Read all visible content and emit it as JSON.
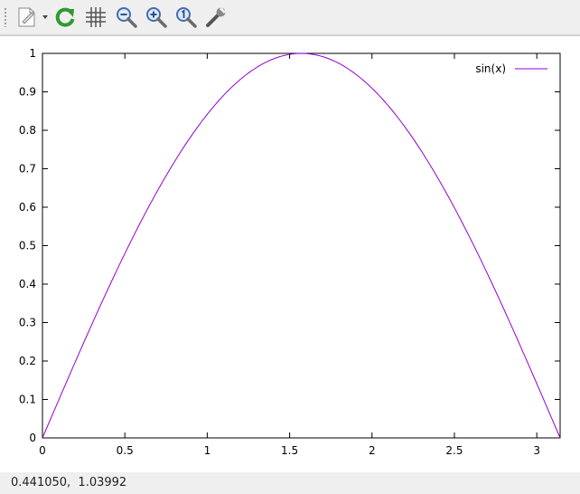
{
  "toolbar": {
    "buttons": [
      {
        "name": "export-icon",
        "has_dropdown": true
      },
      {
        "name": "replot-icon"
      },
      {
        "name": "grid-icon"
      },
      {
        "name": "zoom-out-icon"
      },
      {
        "name": "zoom-in-icon"
      },
      {
        "name": "zoom-reset-icon"
      },
      {
        "name": "settings-wrench-icon"
      }
    ]
  },
  "status": {
    "coordinates": "0.441050,  1.03992"
  },
  "colors": {
    "series": "#9400d3",
    "replot": "#2e9a2e",
    "zoom": "#3c6fb4"
  },
  "chart_data": {
    "type": "line",
    "function": "sin(x)",
    "x_range": [
      0,
      3.14159
    ],
    "ylim": [
      0,
      1
    ],
    "x_ticks": [
      "0",
      "0.5",
      "1",
      "1.5",
      "2",
      "2.5",
      "3"
    ],
    "x_tick_values": [
      0,
      0.5,
      1,
      1.5,
      2,
      2.5,
      3
    ],
    "y_ticks": [
      "0",
      "0.1",
      "0.2",
      "0.3",
      "0.4",
      "0.5",
      "0.6",
      "0.7",
      "0.8",
      "0.9",
      "1"
    ],
    "y_tick_values": [
      0,
      0.1,
      0.2,
      0.3,
      0.4,
      0.5,
      0.6,
      0.7,
      0.8,
      0.9,
      1
    ],
    "series": [
      {
        "name": "sin(x)",
        "color": "#9400d3",
        "x": [
          0,
          0.1571,
          0.3142,
          0.4712,
          0.6283,
          0.7854,
          0.9425,
          1.0996,
          1.2566,
          1.4137,
          1.5708,
          1.7279,
          1.885,
          2.042,
          2.1991,
          2.3562,
          2.5133,
          2.6704,
          2.8274,
          2.9845,
          3.1416
        ],
        "y": [
          0,
          0.1564,
          0.309,
          0.454,
          0.5878,
          0.7071,
          0.809,
          0.891,
          0.9511,
          0.9877,
          1,
          0.9877,
          0.9511,
          0.891,
          0.809,
          0.7071,
          0.5878,
          0.454,
          0.309,
          0.1564,
          0
        ]
      }
    ],
    "legend": "top-right",
    "grid": false
  }
}
